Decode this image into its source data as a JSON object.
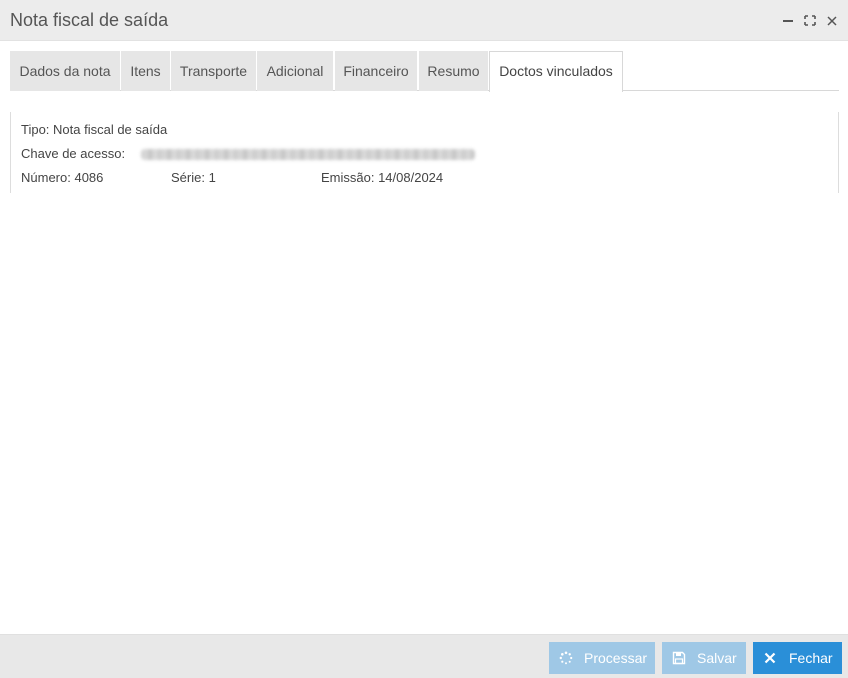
{
  "window": {
    "title": "Nota fiscal de saída"
  },
  "tabs": [
    {
      "label": "Dados da nota",
      "active": false
    },
    {
      "label": "Itens",
      "active": false
    },
    {
      "label": "Transporte",
      "active": false
    },
    {
      "label": "Adicional",
      "active": false
    },
    {
      "label": "Financeiro",
      "active": false
    },
    {
      "label": "Resumo",
      "active": false
    },
    {
      "label": "Doctos vinculados",
      "active": true
    }
  ],
  "document": {
    "tipo": "Tipo: Nota fiscal de saída",
    "chave_label": "Chave de acesso:",
    "numero": "Número: 4086",
    "serie": "Série: 1",
    "emissao": "Emissão: 14/08/2024"
  },
  "footer": {
    "processar_label": "Processar",
    "salvar_label": "Salvar",
    "fechar_label": "Fechar"
  },
  "colors": {
    "primary": "#2a8fd8",
    "primary_disabled": "#9fc8e6",
    "titlebar": "#ececec",
    "tab_inactive": "#e6e6e6"
  }
}
